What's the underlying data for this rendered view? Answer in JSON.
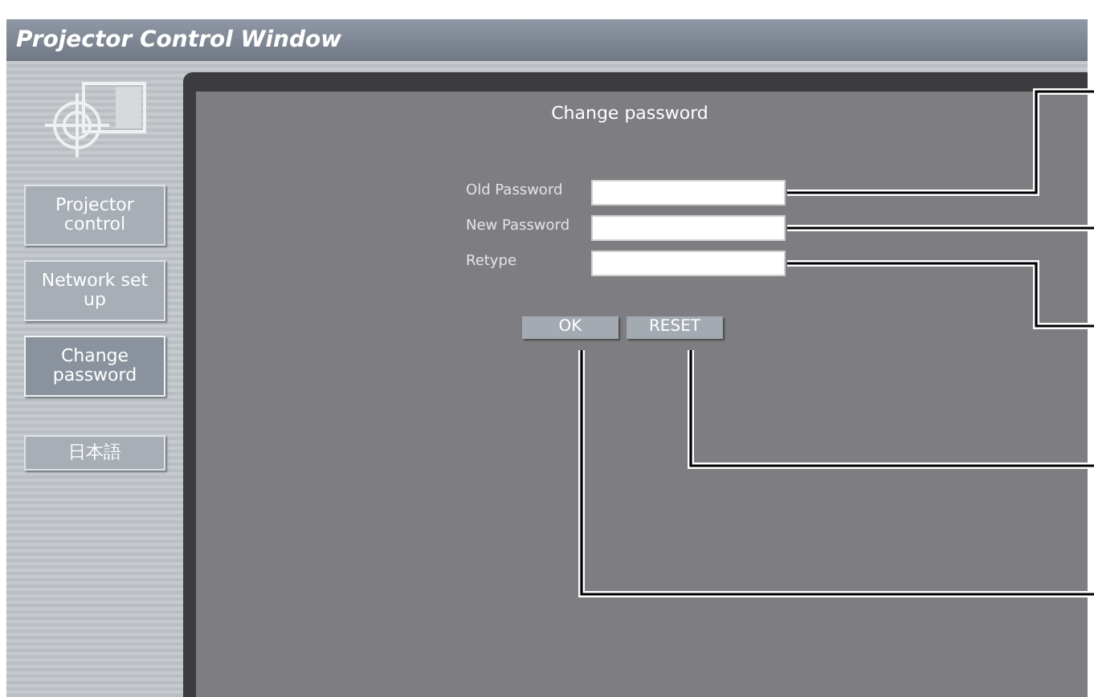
{
  "window": {
    "title": "Projector Control Window"
  },
  "sidebar": {
    "items": [
      {
        "label": "Projector control",
        "selected": false
      },
      {
        "label": "Network set up",
        "selected": false
      },
      {
        "label": "Change password",
        "selected": true
      },
      {
        "label": "日本語",
        "selected": false
      }
    ]
  },
  "panel": {
    "title": "Change password",
    "fields": [
      {
        "label": "Old Password"
      },
      {
        "label": "New Password"
      },
      {
        "label": "Retype"
      }
    ],
    "buttons": [
      "OK",
      "RESET"
    ]
  }
}
